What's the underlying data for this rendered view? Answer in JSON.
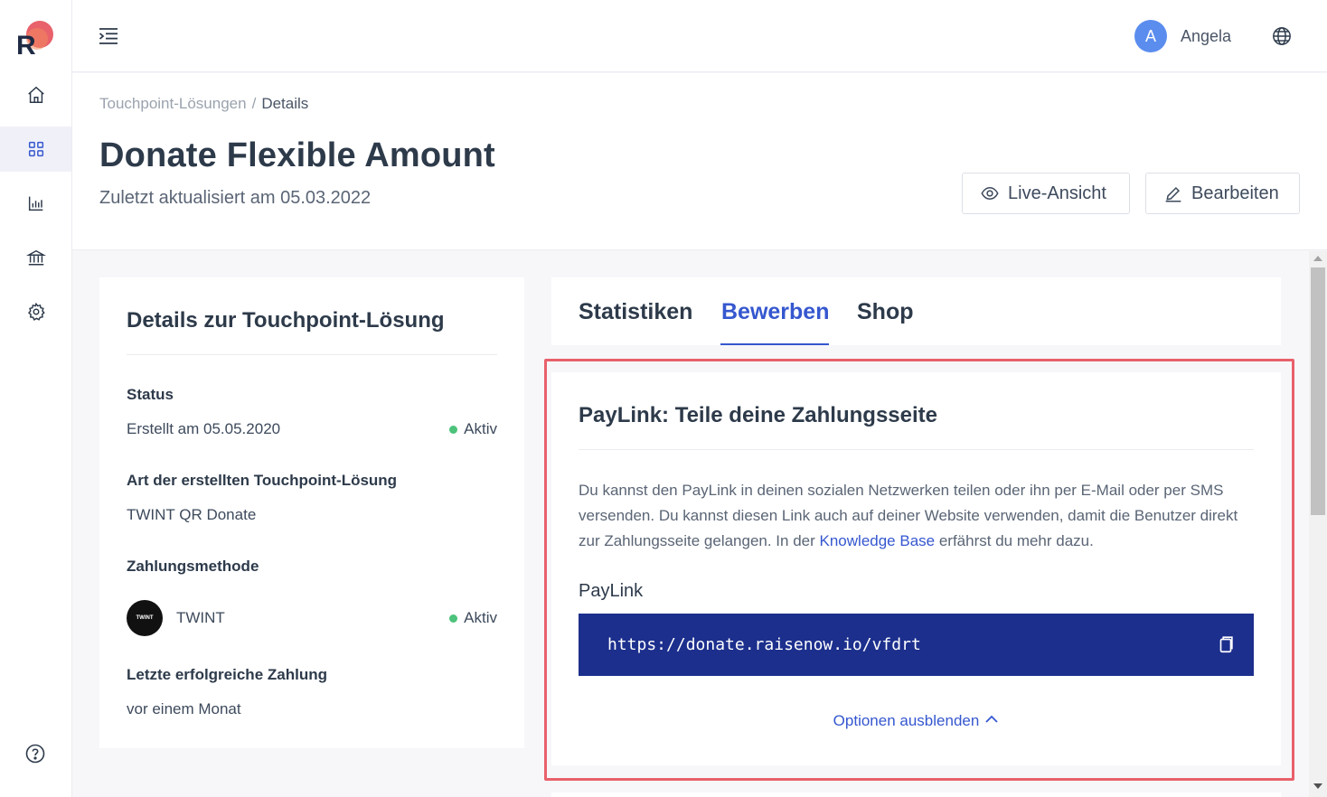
{
  "brand": {
    "logo_letter": "R",
    "accent": "#3557cf",
    "logo_dot": "#e8616b"
  },
  "sidebar": {
    "items": [
      {
        "icon": "home-icon"
      },
      {
        "icon": "grid-icon",
        "active": true
      },
      {
        "icon": "chart-icon"
      },
      {
        "icon": "bank-icon"
      },
      {
        "icon": "gear-icon"
      }
    ],
    "help_icon": "help-icon"
  },
  "topbar": {
    "user_initial": "A",
    "user_name": "Angela"
  },
  "breadcrumb": {
    "parent": "Touchpoint-Lösungen",
    "separator": "/",
    "current": "Details"
  },
  "page": {
    "title": "Donate Flexible Amount",
    "updated": "Zuletzt aktualisiert am 05.03.2022",
    "live_button": "Live-Ansicht",
    "edit_button": "Bearbeiten"
  },
  "details": {
    "title": "Details zur Touchpoint-Lösung",
    "status_label": "Status",
    "status_created": "Erstellt am 05.05.2020",
    "status_value": "Aktiv",
    "type_label": "Art der erstellten Touchpoint-Lösung",
    "type_value": "TWINT QR Donate",
    "payment_label": "Zahlungsmethode",
    "payment_logo_text": "TWINT",
    "payment_name": "TWINT",
    "payment_status": "Aktiv",
    "last_payment_label": "Letzte erfolgreiche Zahlung",
    "last_payment_value": "vor einem Monat"
  },
  "tabs": [
    {
      "label": "Statistiken"
    },
    {
      "label": "Bewerben",
      "active": true
    },
    {
      "label": "Shop"
    }
  ],
  "paylink": {
    "title": "PayLink: Teile deine Zahlungsseite",
    "description_before": "Du kannst den PayLink in deinen sozialen Netzwerken teilen oder ihn per E-Mail oder per SMS versenden. Du kannst diesen Link auch auf deiner Website verwenden, damit die Benutzer direkt zur Zahlungsseite gelangen. In der ",
    "description_link": "Knowledge Base",
    "description_after": " erfährst du mehr dazu.",
    "label": "PayLink",
    "url": "https://donate.raisenow.io/vfdrt",
    "options_toggle": "Optionen ausblenden"
  }
}
